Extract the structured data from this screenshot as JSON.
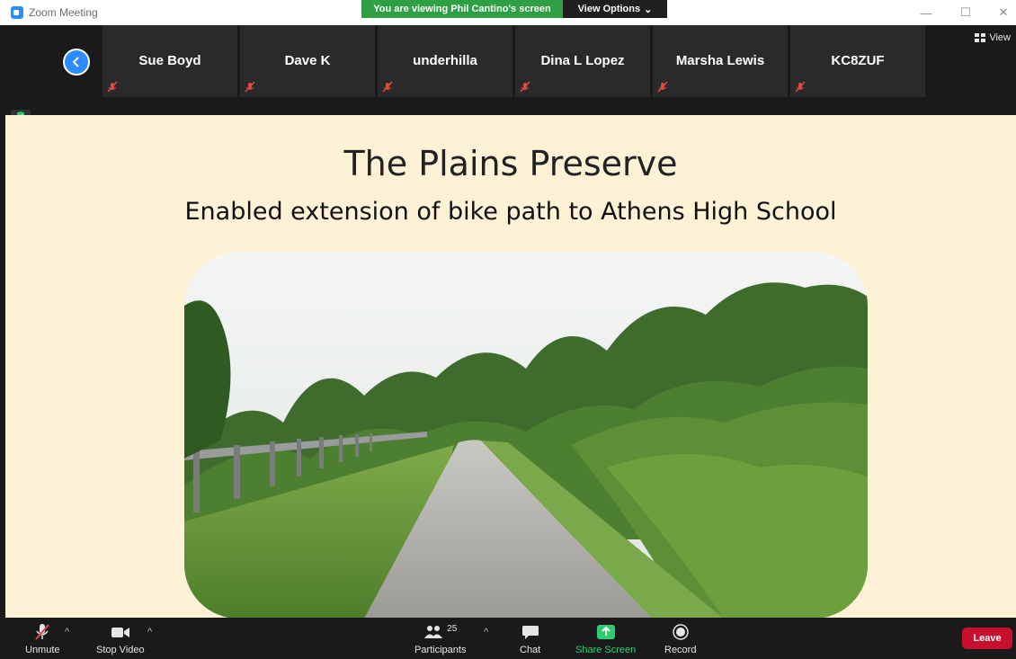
{
  "window": {
    "title": "Zoom Meeting",
    "viewing_banner": "You are viewing Phil Cantino's screen",
    "view_options": "View Options"
  },
  "strip": {
    "participants": [
      {
        "name": "Sue Boyd"
      },
      {
        "name": "Dave K"
      },
      {
        "name": "underhilla"
      },
      {
        "name": "Dina L Lopez"
      },
      {
        "name": "Marsha Lewis"
      },
      {
        "name": "KC8ZUF"
      }
    ],
    "view_label": "View"
  },
  "slide": {
    "title": "The Plains Preserve",
    "subtitle": "Enabled extension of bike path to Athens High School",
    "background": "#fdf1d6"
  },
  "toolbar": {
    "unmute": "Unmute",
    "stop_video": "Stop Video",
    "participants": "Participants",
    "participants_count": "25",
    "chat": "Chat",
    "share_screen": "Share Screen",
    "record": "Record",
    "leave": "Leave"
  },
  "colors": {
    "accent": "#2d8cff",
    "banner_green": "#2ea043",
    "share_green": "#2ecc71",
    "leave_red": "#c8102e"
  }
}
